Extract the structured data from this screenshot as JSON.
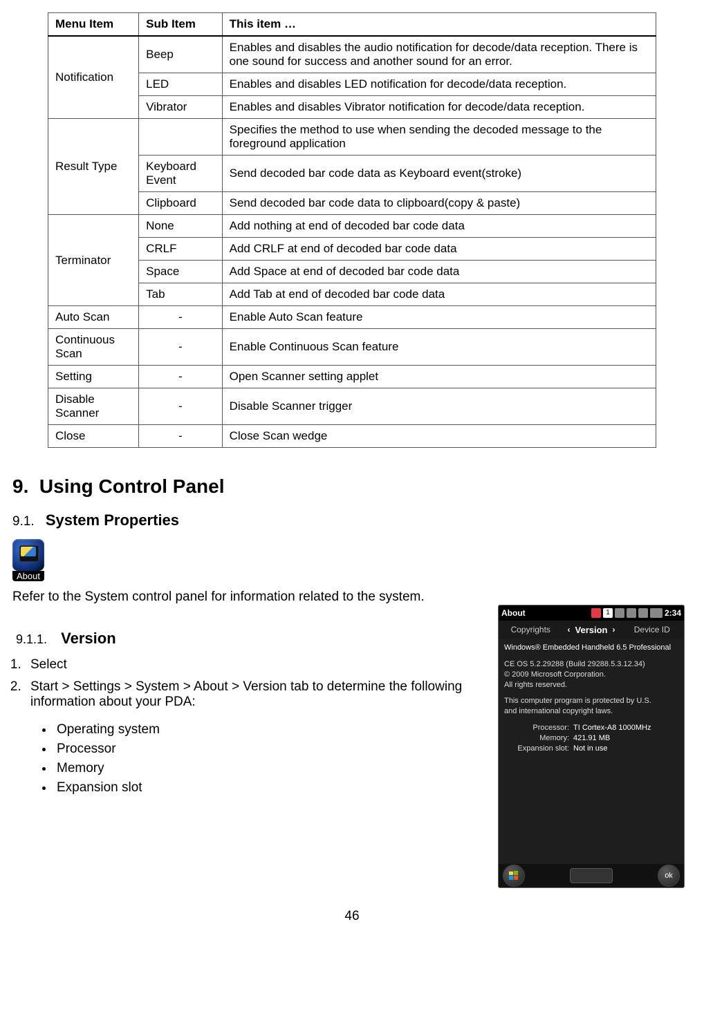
{
  "table": {
    "headers": [
      "Menu Item",
      "Sub Item",
      "This item …"
    ],
    "groups": [
      {
        "menu": "Notification",
        "rows": [
          [
            "Beep",
            "Enables and disables the audio notification for decode/data reception. There is one sound for success and another sound for an error."
          ],
          [
            "LED",
            "Enables and disables LED notification for decode/data reception."
          ],
          [
            "Vibrator",
            "Enables and disables Vibrator notification for decode/data reception."
          ]
        ]
      },
      {
        "menu": "Result Type",
        "intro": "Specifies the method to use when sending the decoded message to the foreground application",
        "rows": [
          [
            "Keyboard Event",
            "Send decoded bar code data as Keyboard event(stroke)"
          ],
          [
            "Clipboard",
            "Send decoded bar code data to clipboard(copy & paste)"
          ]
        ]
      },
      {
        "menu": "Terminator",
        "rows": [
          [
            "None",
            "Add nothing at end of decoded bar code data"
          ],
          [
            "CRLF",
            "Add CRLF at end of decoded bar code data"
          ],
          [
            "Space",
            "Add Space at end of decoded bar code data"
          ],
          [
            "Tab",
            "Add Tab at end of decoded bar code data"
          ]
        ]
      }
    ],
    "singles": [
      [
        "Auto Scan",
        "-",
        "Enable Auto Scan feature"
      ],
      [
        "Continuous Scan",
        "-",
        "Enable Continuous Scan feature"
      ],
      [
        "Setting",
        "-",
        "Open Scanner setting applet"
      ],
      [
        "Disable Scanner",
        "-",
        "Disable Scanner trigger"
      ],
      [
        "Close",
        "-",
        "Close Scan wedge"
      ]
    ]
  },
  "section": {
    "number": "9.",
    "title": "Using Control Panel"
  },
  "subsection": {
    "number": "9.1.",
    "title": "System Properties",
    "icon_label": "About",
    "body": "Refer to the System control panel for information related to the system."
  },
  "subsub": {
    "number": "9.1.1.",
    "title": "Version"
  },
  "steps": [
    "Select",
    "Start > Settings > System > About > Version tab to determine the following information about your PDA:"
  ],
  "bullets": [
    "Operating system",
    "Processor",
    "Memory",
    "Expansion slot"
  ],
  "device": {
    "title": "About",
    "time": "2:34",
    "tabs": {
      "left": "Copyrights",
      "mid": "Version",
      "right": "Device ID"
    },
    "os_line": "Windows® Embedded Handheld 6.5 Professional",
    "build_line": "CE OS 5.2.29288 (Build 29288.5.3.12.34)",
    "copy_line": "© 2009 Microsoft Corporation.",
    "rights_line": "All rights reserved.",
    "legal1": "This computer program is protected by U.S.",
    "legal2": "and international copyright laws.",
    "processor_label": "Processor:",
    "processor_value": "TI Cortex-A8 1000MHz",
    "memory_label": "Memory:",
    "memory_value": "421.91 MB",
    "expansion_label": "Expansion slot:",
    "expansion_value": "Not in use",
    "ok": "ok"
  },
  "page_number": "46"
}
